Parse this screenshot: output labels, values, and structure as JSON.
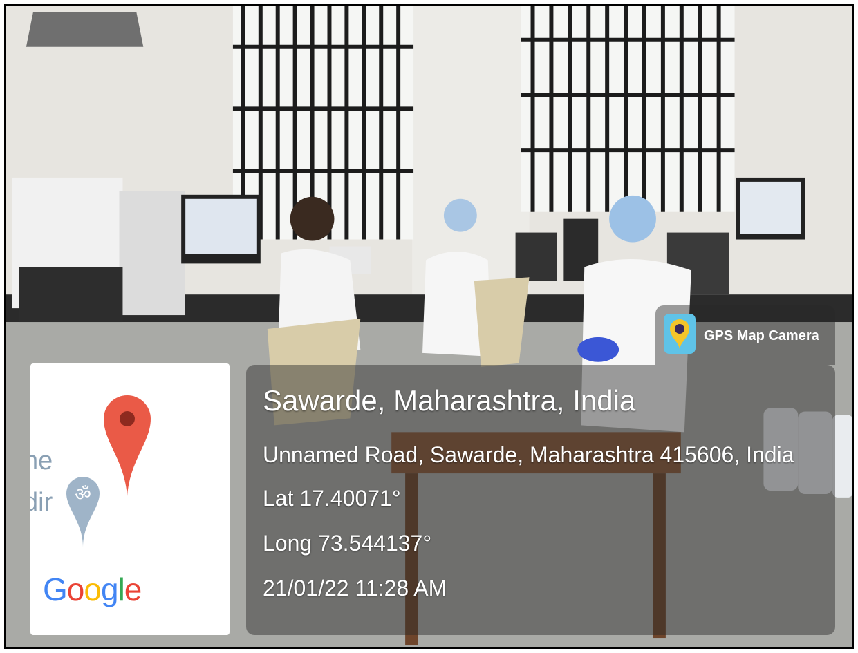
{
  "map": {
    "label_1": "ne",
    "label_2": "dir",
    "google_letters": [
      {
        "char": "G",
        "color": "#4285F4"
      },
      {
        "char": "o",
        "color": "#EA4335"
      },
      {
        "char": "o",
        "color": "#FBBC05"
      },
      {
        "char": "g",
        "color": "#4285F4"
      },
      {
        "char": "l",
        "color": "#34A853"
      },
      {
        "char": "e",
        "color": "#EA4335"
      }
    ]
  },
  "badge": {
    "app_name": "GPS Map Camera",
    "icon": "gps-camera-app-icon"
  },
  "info": {
    "place": "Sawarde, Maharashtra, India",
    "address": "Unnamed Road, Sawarde, Maharashtra 415606, India",
    "lat": "Lat 17.40071°",
    "long": "Long 73.544137°",
    "datetime": "21/01/22 11:28 AM"
  },
  "colors": {
    "pin": "#EA5A47",
    "overlay": "rgba(40,40,40,0.45)"
  }
}
